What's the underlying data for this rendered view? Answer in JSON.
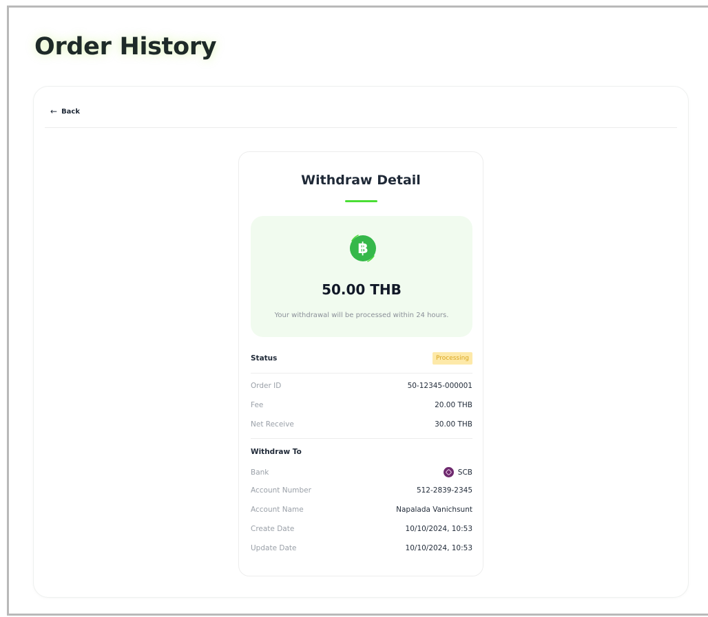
{
  "page": {
    "title": "Order History"
  },
  "nav": {
    "back_label": "Back",
    "back_icon": "arrow-left-icon"
  },
  "detail": {
    "title": "Withdraw Detail",
    "coin_icon": "baht-coin-icon",
    "coin_glyph": "฿",
    "amount": "50.00 THB",
    "note": "Your withdrawal will be processed within 24 hours.",
    "status": {
      "label": "Status",
      "value": "Processing"
    },
    "order_id": {
      "label": "Order ID",
      "value": "50-12345-000001"
    },
    "fee": {
      "label": "Fee",
      "value": "20.00 THB"
    },
    "net_receive": {
      "label": "Net Receive",
      "value": "30.00 THB"
    },
    "withdraw_to": {
      "label": "Withdraw To",
      "bank": {
        "label": "Bank",
        "value": "SCB",
        "logo_icon": "scb-bank-logo-icon"
      },
      "account_number": {
        "label": "Account Number",
        "value": "512-2839-2345"
      },
      "account_name": {
        "label": "Account Name",
        "value": "Napalada Vanichsunt"
      },
      "create_date": {
        "label": "Create Date",
        "value": "10/10/2024, 10:53"
      },
      "update_date": {
        "label": "Update Date",
        "value": "10/10/2024, 10:53"
      }
    }
  },
  "colors": {
    "accent_green": "#4ade34",
    "coin_green": "#35b84a",
    "amount_bg": "#f1fbef",
    "badge_bg": "#fde9a9",
    "badge_text": "#d9a520",
    "bank_purple": "#6e2a6e"
  }
}
